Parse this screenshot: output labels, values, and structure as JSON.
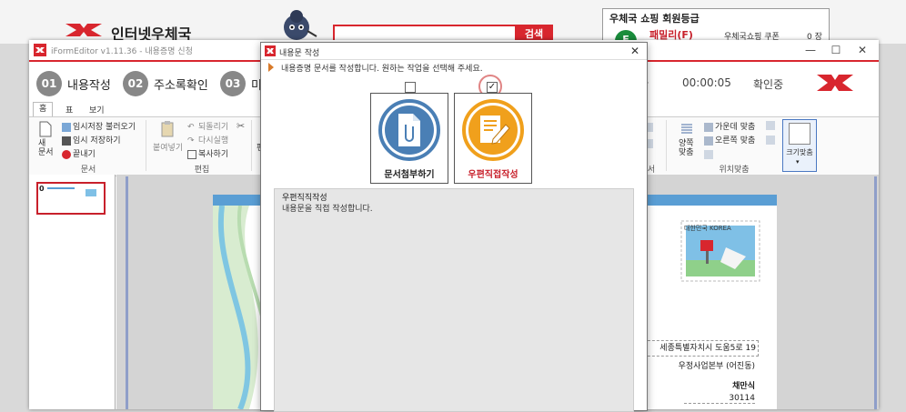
{
  "site": {
    "title": "인터넷우체국",
    "search_button": "검색",
    "member_title": "우체국 쇼핑 회원등급",
    "member_grade": "패밀리(F)",
    "member_avatar": "F",
    "coupon_label": "우체국쇼핑 쿠폰",
    "coupon_count": "0 장"
  },
  "editor": {
    "window_title": "iFormEditor v1.11.36 - 내용증명 신청",
    "minimize": "—",
    "maximize": "☐",
    "close": "✕",
    "steps": [
      {
        "num": "01",
        "label": "내용작성"
      },
      {
        "num": "02",
        "label": "주소록확인"
      },
      {
        "num": "03",
        "label": "미"
      }
    ],
    "elapsed_label": "간",
    "timer": "00:00:05",
    "status": "확인중",
    "tabs": [
      "홈",
      "표",
      "보기"
    ],
    "ribbon": {
      "new_doc": "새\n문서",
      "load_temp": "임시저장 불러오기",
      "save_temp": "임시 저장하기",
      "close": "끝내기",
      "group_doc": "문서",
      "paste": "붙여넣기",
      "undo": "되돌리기",
      "redo": "다시실행",
      "copy": "복사하기",
      "group_edit": "편집",
      "align_both": "양쪽\n맞춤",
      "align_center": "가운데 맞춤",
      "align_right": "오른쪽 맞춤",
      "group_position": "위치맞춤",
      "group_partial": "서",
      "fit_size": "크기맞춤",
      "partial_edit": "편"
    },
    "thumb_page_number": "0",
    "document": {
      "address_line1": "세종특별자치시 도움5로 19",
      "address_line2": "우정사업본부 (어진동)",
      "name": "채만식",
      "zip": "30114",
      "stamp_text": "대한민국 KOREA"
    }
  },
  "dialog": {
    "title": "내용문 작성",
    "close": "✕",
    "instruction": "내용증명 문서를 작성합니다. 원하는 작업을 선택해 주세요.",
    "option_attach": {
      "label": "문서첨부하기",
      "checked": false
    },
    "option_write": {
      "label": "우편직접작성",
      "checked": true,
      "check_mark": "✓"
    },
    "description_title": "우편직직작성",
    "description_text": "내용문을 직접 작성합니다."
  },
  "colors": {
    "brand_red": "#d8262e",
    "step_gray": "#888888",
    "grade_green": "#1a8d3c",
    "attach_blue": "#4a7fb5",
    "write_orange": "#f0a01c"
  }
}
